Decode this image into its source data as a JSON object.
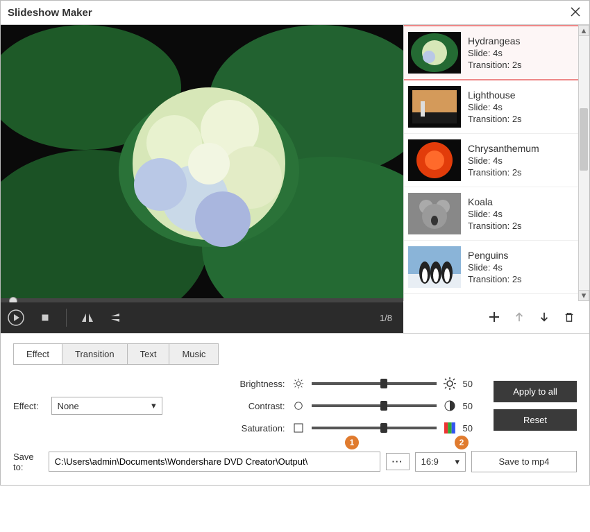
{
  "window": {
    "title": "Slideshow Maker"
  },
  "preview": {
    "counter": "1/8"
  },
  "slides": [
    {
      "name": "Hydrangeas",
      "slide": "Slide: 4s",
      "transition": "Transition: 2s",
      "selected": true
    },
    {
      "name": "Lighthouse",
      "slide": "Slide: 4s",
      "transition": "Transition: 2s",
      "selected": false
    },
    {
      "name": "Chrysanthemum",
      "slide": "Slide: 4s",
      "transition": "Transition: 2s",
      "selected": false
    },
    {
      "name": "Koala",
      "slide": "Slide: 4s",
      "transition": "Transition: 2s",
      "selected": false
    },
    {
      "name": "Penguins",
      "slide": "Slide: 4s",
      "transition": "Transition: 2s",
      "selected": false
    }
  ],
  "tabs": {
    "effect": "Effect",
    "transition": "Transition",
    "text": "Text",
    "music": "Music",
    "active": "effect"
  },
  "effect": {
    "label": "Effect:",
    "selected": "None",
    "brightness_label": "Brightness:",
    "contrast_label": "Contrast:",
    "saturation_label": "Saturation:",
    "brightness": "50",
    "contrast": "50",
    "saturation": "50",
    "apply_all": "Apply to all",
    "reset": "Reset"
  },
  "save": {
    "label": "Save to:",
    "path": "C:\\Users\\admin\\Documents\\Wondershare DVD Creator\\Output\\",
    "browse": "···",
    "ratio": "16:9",
    "save_btn": "Save to mp4"
  },
  "annotations": {
    "a1": "1",
    "a2": "2"
  }
}
